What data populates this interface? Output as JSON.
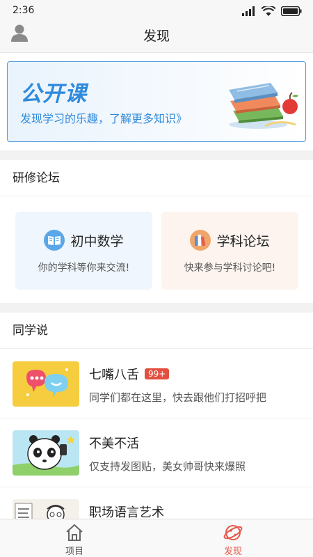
{
  "status_bar": {
    "time": "2:36"
  },
  "header": {
    "title": "发现",
    "avatar_icon": "user-icon"
  },
  "banner": {
    "title": "公开课",
    "subtitle": "发现学习的乐趣，了解更多知识》",
    "accent": "#2f8adc"
  },
  "forum": {
    "heading": "研修论坛",
    "cards": [
      {
        "title": "初中数学",
        "desc": "你的学科等你来交流!",
        "icon": "book-icon"
      },
      {
        "title": "学科论坛",
        "desc": "快来参与学科讨论吧!",
        "icon": "books-icon"
      }
    ]
  },
  "classmates": {
    "heading": "同学说",
    "items": [
      {
        "title": "七嘴八舌",
        "badge": "99+",
        "desc": "同学们都在这里，快去跟他们打招呼把"
      },
      {
        "title": "不美不活",
        "badge": "",
        "desc": "仅支持发图贴，美女帅哥快来爆照"
      },
      {
        "title": "职场语言艺术",
        "badge": "",
        "desc": ""
      }
    ]
  },
  "bottom_nav": {
    "items": [
      {
        "label": "项目",
        "icon": "home-icon"
      },
      {
        "label": "发现",
        "icon": "planet-icon",
        "active": true
      }
    ],
    "active_color": "#e5584a"
  }
}
